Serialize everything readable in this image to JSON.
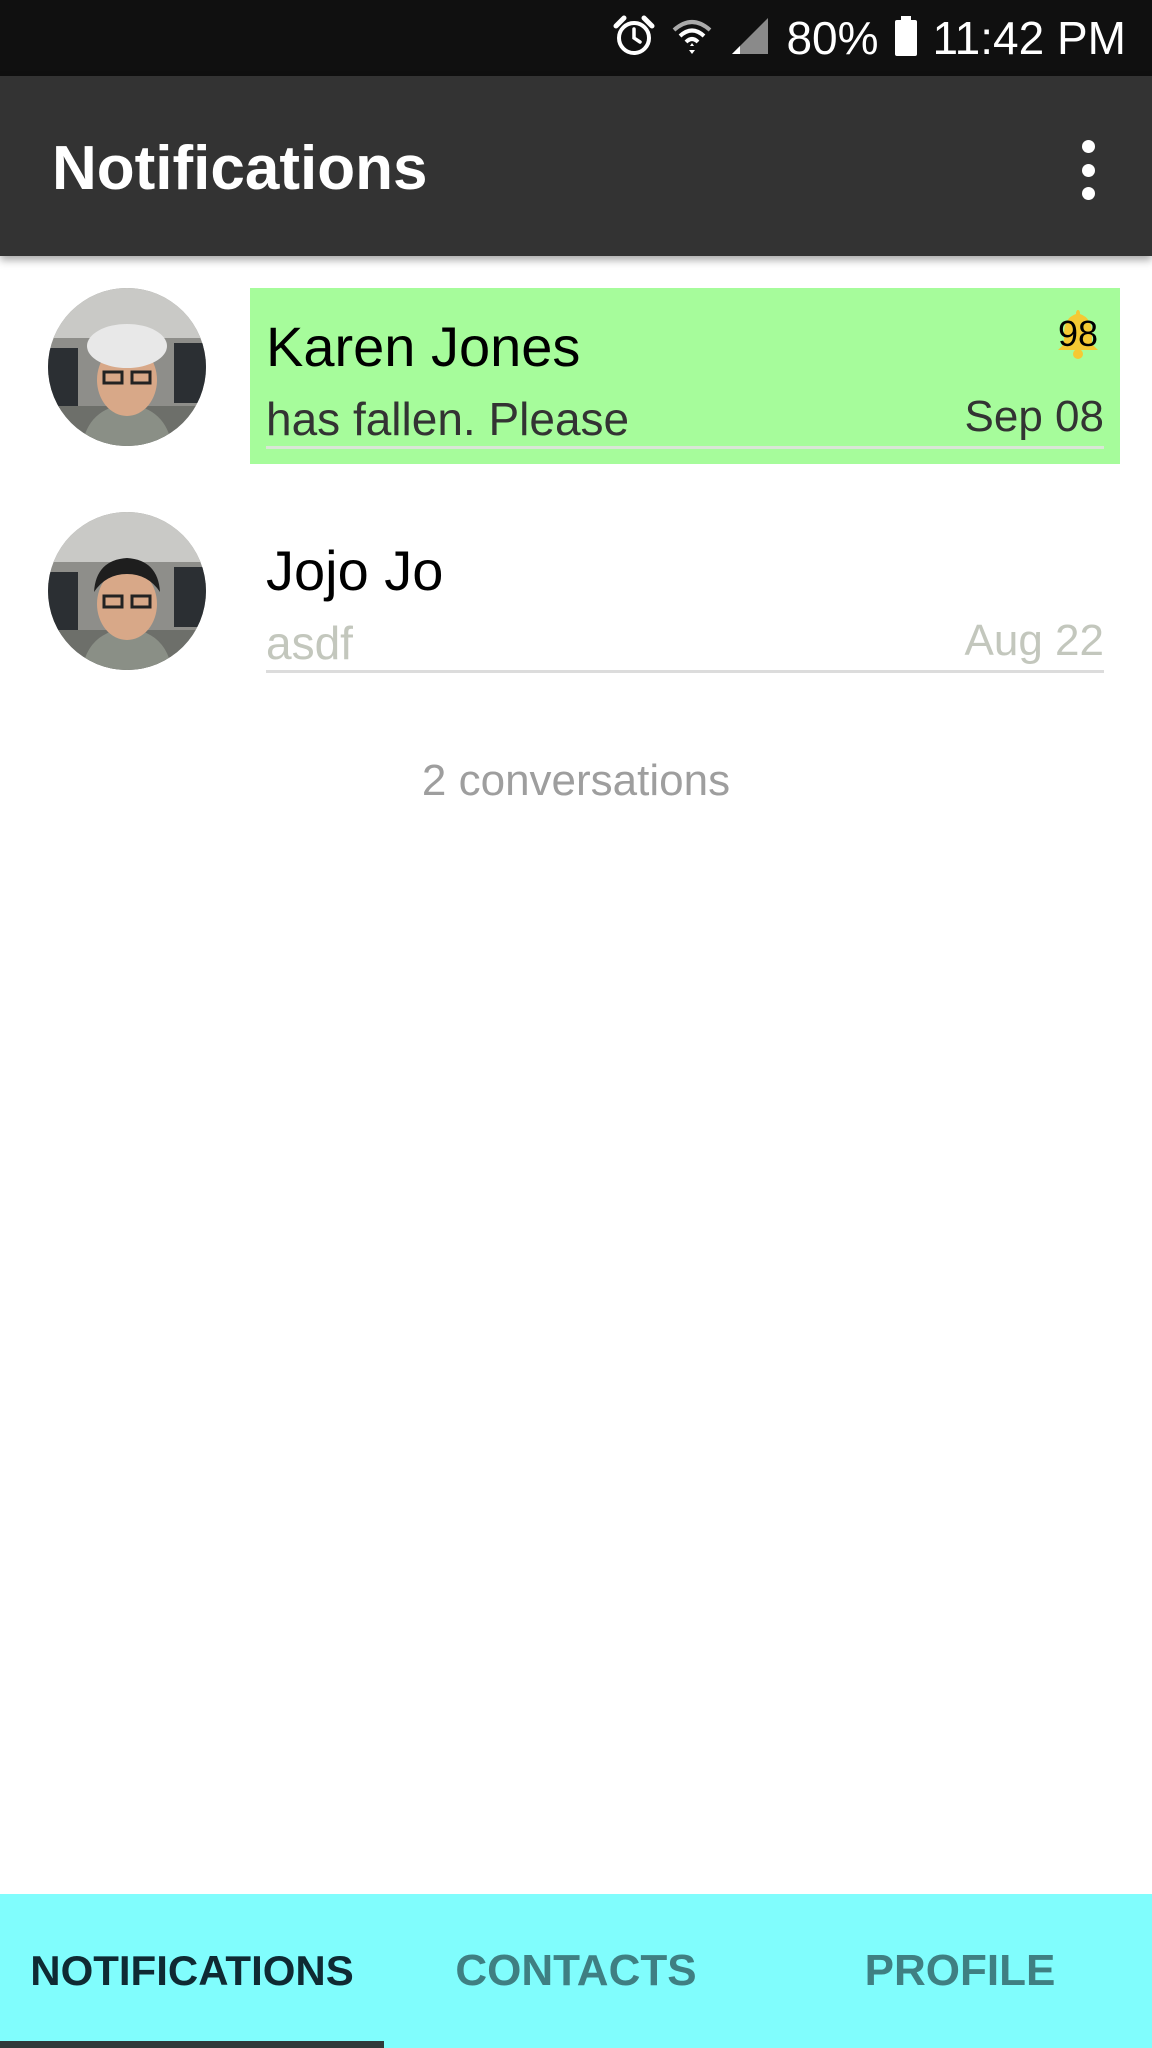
{
  "status_bar": {
    "battery": "80%",
    "time": "11:42 PM",
    "icons": [
      "alarm-icon",
      "wifi-icon",
      "signal-icon",
      "battery-icon"
    ]
  },
  "app_bar": {
    "title": "Notifications",
    "menu_icon": "more-vert-icon"
  },
  "conversations": [
    {
      "name": "Karen Jones",
      "message": "has fallen. Please",
      "date": "Sep 08",
      "badge": "98",
      "highlighted": true,
      "highlight_color": "#a6fc9b"
    },
    {
      "name": "Jojo Jo",
      "message": "asdf",
      "date": "Aug 22",
      "highlighted": false
    }
  ],
  "footer": {
    "count_text": "2 conversations"
  },
  "tabs": [
    {
      "label": "NOTIFICATIONS",
      "active": true
    },
    {
      "label": "CONTACTS",
      "active": false
    },
    {
      "label": "PROFILE",
      "active": false
    }
  ],
  "colors": {
    "status_bar_bg": "#101010",
    "app_bar_bg": "#333333",
    "tab_bar_bg": "#80fdfd",
    "highlight": "#a6fc9b",
    "badge_bell": "#f5c933"
  }
}
